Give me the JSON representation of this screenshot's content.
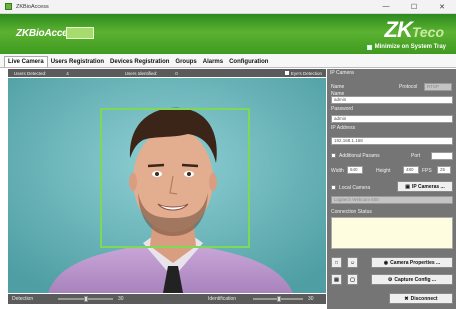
{
  "window": {
    "title": "ZKBioAccess",
    "minimize": "—",
    "maximize": "☐",
    "close": "✕"
  },
  "header": {
    "brand": "ZKBioAccess",
    "logo": "ZK",
    "logo_suffix": "Teco",
    "tray_label": "Minimize on System Tray"
  },
  "tabs": [
    {
      "label": "Live Camera",
      "active": true
    },
    {
      "label": "Users Registration"
    },
    {
      "label": "Devices Registration"
    },
    {
      "label": "Groups"
    },
    {
      "label": "Alarms"
    },
    {
      "label": "Configuration"
    }
  ],
  "status": {
    "detected_label": "Users Detected:",
    "detected_value": "4",
    "identified_label": "Users Identified:",
    "identified_value": "0",
    "eyes_label": "Eye's Detection"
  },
  "bottom": {
    "detection_label": "Detection",
    "detection_value": "30",
    "identification_label": "Identification",
    "identification_value": "30"
  },
  "panel": {
    "legend": "IP Camera",
    "name_label": "Name",
    "protocol_label": "Protocol",
    "protocol_value": "RTSP",
    "user_label": "Name",
    "user_value": "admin",
    "password_label": "Password",
    "password_value": "admin",
    "ip_label": "IP Address",
    "ip_value": "192.168.1.168",
    "additional_label": "Additional Params",
    "port_label": "Port",
    "width_label": "Width",
    "width_value": "640",
    "height_label": "Height",
    "height_value": "480",
    "fps_label": "FPS",
    "fps_value": "25",
    "local_label": "Local Camera",
    "ipcamera_button": "IP Cameras ...",
    "webcam_value": "Logitech Webcam 500",
    "connection_label": "Connection Status",
    "camera_properties": "Camera Properties ...",
    "capture_config": "Capture Config ...",
    "disconnect": "Disconnect"
  }
}
